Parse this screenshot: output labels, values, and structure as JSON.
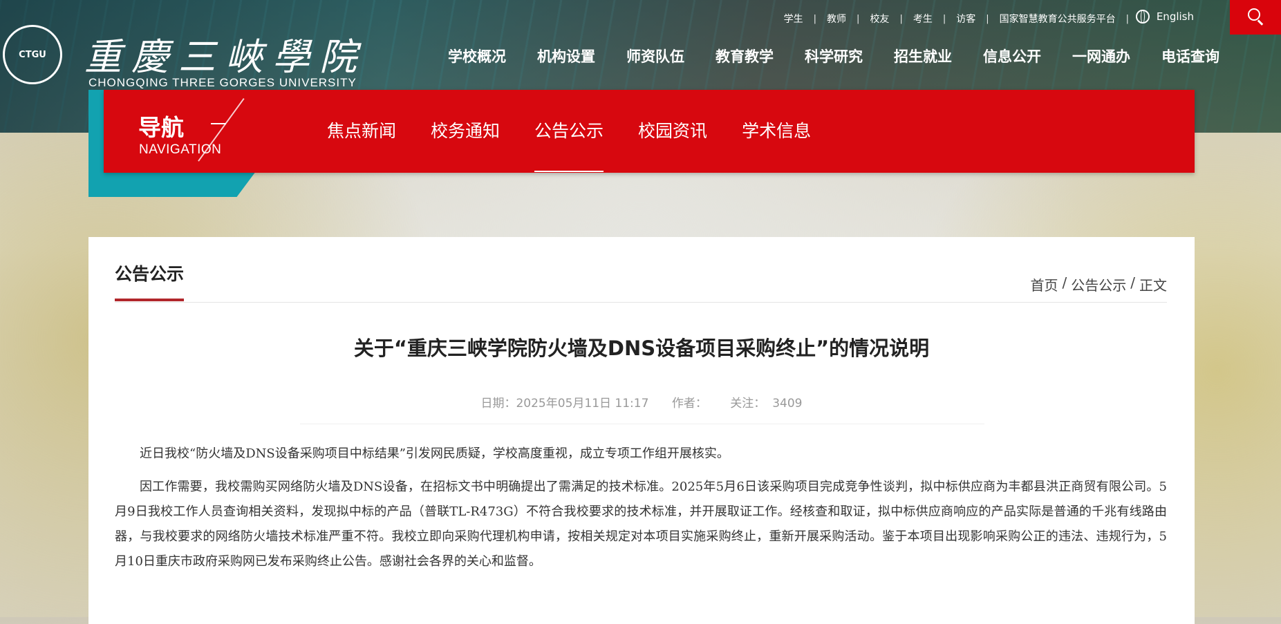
{
  "header": {
    "logo_text_cn": "重慶三峽學院",
    "logo_text_en": "CHONGQING THREE GORGES UNIVERSITY",
    "logo_seal_text": "CTGU",
    "utility_links": [
      "学生",
      "教师",
      "校友",
      "考生",
      "访客",
      "国家智慧教育公共服务平台"
    ],
    "language_label": "English",
    "main_nav": [
      "学校概况",
      "机构设置",
      "师资队伍",
      "教育教学",
      "科学研究",
      "招生就业",
      "信息公开",
      "一网通办",
      "电话查询"
    ]
  },
  "sub_nav": {
    "label_cn": "导航",
    "label_en": "NAVIGATION",
    "items": [
      "焦点新闻",
      "校务通知",
      "公告公示",
      "校园资讯",
      "学术信息"
    ],
    "active_index": 2
  },
  "panel": {
    "section_title": "公告公示",
    "breadcrumb": [
      "首页",
      "/",
      "公告公示",
      "/",
      "正文"
    ]
  },
  "article": {
    "title": "关于“重庆三峡学院防火墙及DNS设备项目采购终止”的情况说明",
    "date": "日期：2025年05月11日 11:17",
    "author": "作者：",
    "views_label": "关注：",
    "views": "3409",
    "paragraphs": [
      "近日我校“防火墙及DNS设备采购项目中标结果”引发网民质疑，学校高度重视，成立专项工作组开展核实。",
      "因工作需要，我校需购买网络防火墙及DNS设备，在招标文书中明确提出了需满足的技术标准。2025年5月6日该采购项目完成竞争性谈判，拟中标供应商为丰都县洪正商贸有限公司。5月9日我校工作人员查询相关资料，发现拟中标的产品（普联TL-R473G）不符合我校要求的技术标准，并开展取证工作。经核查和取证，拟中标供应商响应的产品实际是普通的千兆有线路由器，与我校要求的网络防火墙技术标准严重不符。我校立即向采购代理机构申请，按相关规定对本项目实施采购终止，重新开展采购活动。鉴于本项目出现影响采购公正的违法、违规行为，5月10日重庆市政府采购网已发布采购终止公告。感谢社会各界的关心和监督。"
    ]
  },
  "colors": {
    "brand_red": "#d7080f",
    "teal": "#12a2b0",
    "underline_red": "#b1262b"
  }
}
